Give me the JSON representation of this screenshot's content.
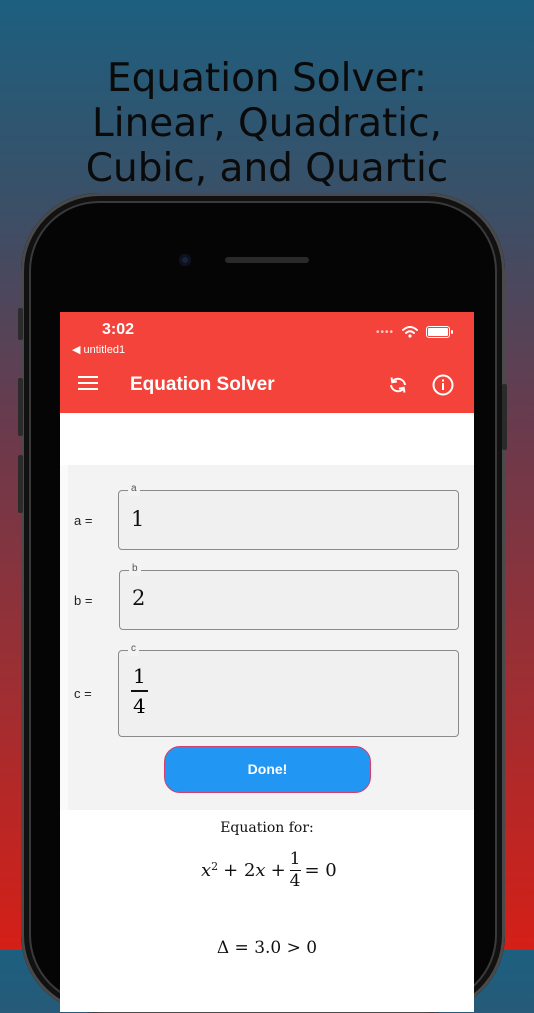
{
  "promo": {
    "title": "Equation Solver: Linear, Quadratic, Cubic, and Quartic"
  },
  "status_bar": {
    "time": "3:02",
    "back_app": "◀ untitled1",
    "signal": "••••"
  },
  "app_bar": {
    "title": "Equation Solver",
    "background": "#f4433a",
    "icons": [
      "menu-icon",
      "refresh-icon",
      "info-icon"
    ]
  },
  "form": {
    "fields": [
      {
        "row_label": "a =",
        "legend": "a",
        "value": "1"
      },
      {
        "row_label": "b =",
        "legend": "b",
        "value": "2"
      },
      {
        "row_label": "c =",
        "legend": "c",
        "numerator": "1",
        "denominator": "4"
      }
    ],
    "done_label": "Done!",
    "done_color": "#2196f3"
  },
  "result": {
    "caption": "Equation for:",
    "equation": {
      "x": "x",
      "exp": "2",
      "plus1": "+ 2",
      "x2": "x",
      "plus2": "+",
      "num": "1",
      "den": "4",
      "eq": "= 0"
    },
    "discriminant_partial": "Δ = 3.0 > 0"
  }
}
